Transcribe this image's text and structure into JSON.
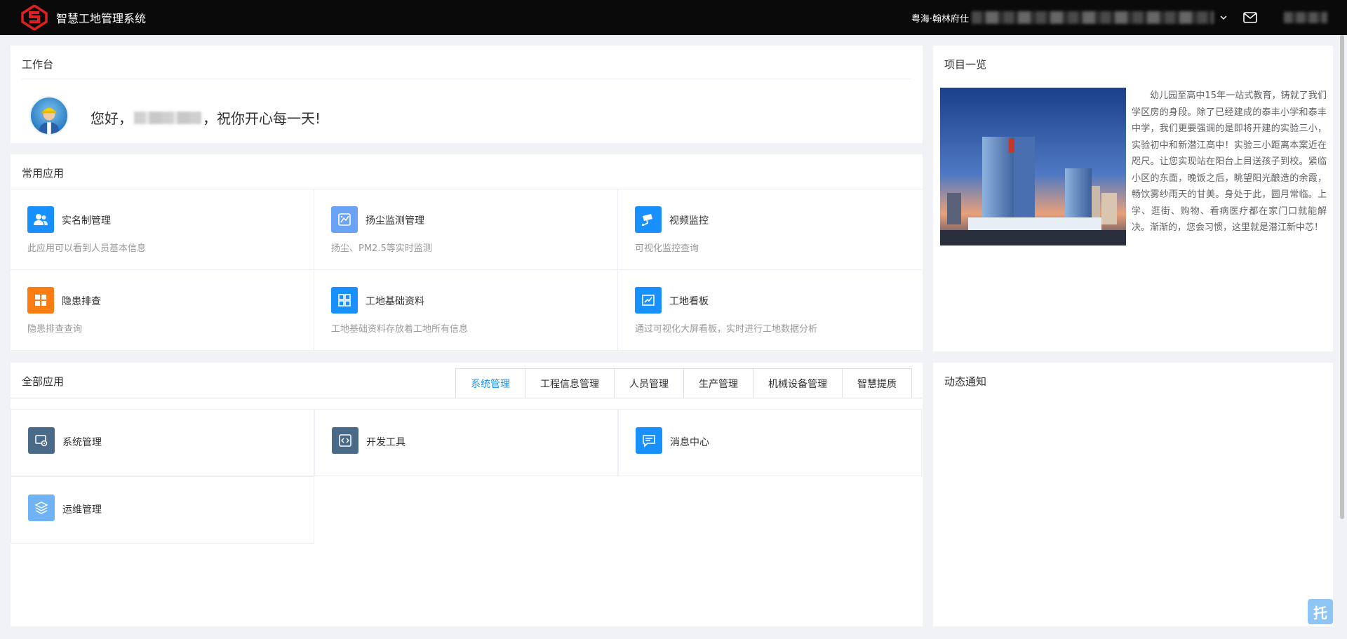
{
  "header": {
    "app_title": "智慧工地管理系统",
    "project_prefix": "粤海·翰林府仕"
  },
  "workbench": {
    "title": "工作台",
    "greeting_prefix": "您好，",
    "greeting_suffix": "，祝你开心每一天!"
  },
  "common_apps": {
    "title": "常用应用",
    "items": [
      {
        "name": "实名制管理",
        "desc": "此应用可以看到人员基本信息",
        "icon": "users-icon",
        "color": "#1890ff"
      },
      {
        "name": "扬尘监测管理",
        "desc": "扬尘、PM2.5等实时监测",
        "icon": "dust-icon",
        "color": "#6aa3f5"
      },
      {
        "name": "视频监控",
        "desc": "可视化监控查询",
        "icon": "camera-icon",
        "color": "#1890ff"
      },
      {
        "name": "隐患排查",
        "desc": "隐患排查查询",
        "icon": "grid-icon",
        "color": "#fa7d14"
      },
      {
        "name": "工地基础资料",
        "desc": "工地基础资料存放着工地所有信息",
        "icon": "apps-icon",
        "color": "#1890ff"
      },
      {
        "name": "工地看板",
        "desc": "通过可视化大屏看板，实时进行工地数据分析",
        "icon": "chart-board-icon",
        "color": "#1890ff"
      }
    ]
  },
  "all_apps": {
    "title": "全部应用",
    "tabs": [
      "系统管理",
      "工程信息管理",
      "人员管理",
      "生产管理",
      "机械设备管理",
      "智慧提质"
    ],
    "active_tab": "系统管理",
    "tiles": [
      {
        "name": "系统管理",
        "icon": "system-settings-icon",
        "color": "#4a6a8a"
      },
      {
        "name": "开发工具",
        "icon": "code-icon",
        "color": "#4a6a8a"
      },
      {
        "name": "消息中心",
        "icon": "message-icon",
        "color": "#1890ff"
      },
      {
        "name": "运维管理",
        "icon": "layers-icon",
        "color": "#6fb3f5"
      }
    ]
  },
  "project": {
    "title": "项目一览",
    "description": "幼儿园至高中15年一站式教育，铸就了我们学区房的身段。除了已经建成的泰丰小学和泰丰中学，我们更要强调的是即将开建的实验三小，实验初中和新潜江高中！实验三小距离本案近在咫尺。让您实现站在阳台上目送孩子到校。紧临小区的东面，晚饭之后，眺望阳光酿造的余霞，畅饮雾纱雨天的甘美。身处于此，圆月常临。上学、逛街、购物、看病医疗都在家门口就能解决。渐渐的，您会习惯，这里就是潜江新中芯！"
  },
  "notify": {
    "title": "动态通知"
  },
  "float_button": {
    "label": "托"
  }
}
